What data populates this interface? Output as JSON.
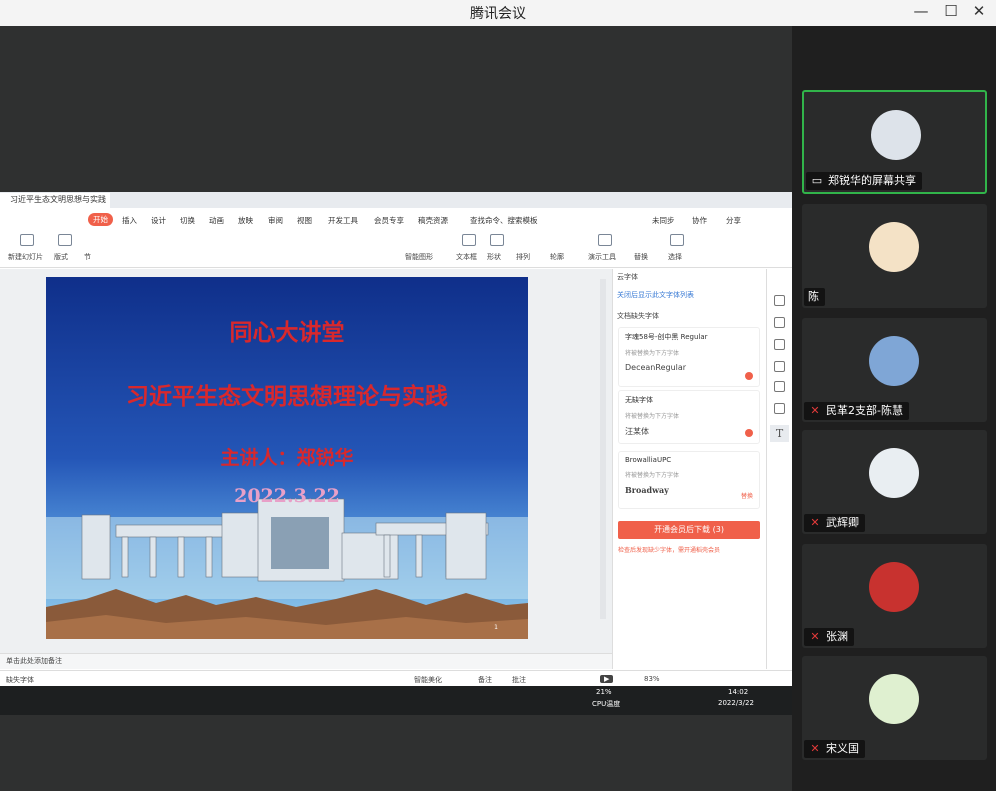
{
  "window": {
    "title": "腾讯会议",
    "controls": [
      "—",
      "☐",
      "✕"
    ]
  },
  "wps": {
    "tab_title": "习近平生态文明思想与实践",
    "menus": [
      "开始",
      "插入",
      "设计",
      "切换",
      "动画",
      "放映",
      "审阅",
      "视图",
      "开发工具",
      "会员专享",
      "稿壳资源",
      "查找命令、搜索模板"
    ],
    "right_actions": [
      "未同步",
      "协作",
      "分享"
    ],
    "ribbon_labels": [
      "新建幻灯片",
      "版式",
      "节",
      "智能图形",
      "文本框",
      "形状",
      "排列",
      "轮廓",
      "演示工具",
      "替换",
      "选择"
    ],
    "notes_placeholder": "单击此处添加备注",
    "status": {
      "missing_font": "缺失字体",
      "smart_beautify": "智能美化",
      "notes": "备注",
      "comment": "批注",
      "zoom": "83%"
    }
  },
  "slide": {
    "line1": "同心大讲堂",
    "line2": "习近平生态文明思想理论与实践",
    "line3": "主讲人：郑锐华",
    "line4": "2022.3.22",
    "page": "1"
  },
  "font_panel": {
    "header": "云字体",
    "link": "关闭后显示此文字体列表",
    "section": "文档缺失字体",
    "cards": [
      {
        "name": "字魂58号-创中黑 Regular",
        "sub": "将被替换为下方字体",
        "sample": "DeceanRegular"
      },
      {
        "name": "无缺字体",
        "sub": "将被替换为下方字体",
        "sample": "汪某体"
      },
      {
        "name": "BrowalliaUPC",
        "sub": "将被替换为下方字体",
        "sample": "Broadway",
        "action": "替换"
      }
    ],
    "button": "开通会员后下载 (3)",
    "note": "检查后发现缺少字体，需开通稻壳会员"
  },
  "taskbar": {
    "cpu_percent": "21%",
    "cpu_label": "CPU温度",
    "time": "14:02",
    "date": "2022/3/22"
  },
  "participants": [
    {
      "name": "郑锐华的屏幕共享",
      "muted": false,
      "active": true,
      "avatar_color": "#dde3ea"
    },
    {
      "name": "陈",
      "muted": false,
      "active": false,
      "avatar_color": "#f4e2c6"
    },
    {
      "name": "民革2支部-陈慧",
      "muted": true,
      "active": false,
      "avatar_color": "#7fa6d6"
    },
    {
      "name": "武辉卿",
      "muted": true,
      "active": false,
      "avatar_color": "#e9eef2"
    },
    {
      "name": "张渊",
      "muted": true,
      "active": false,
      "avatar_color": "#c8322f"
    },
    {
      "name": "宋义国",
      "muted": true,
      "active": false,
      "avatar_color": "#dff0d0"
    }
  ]
}
